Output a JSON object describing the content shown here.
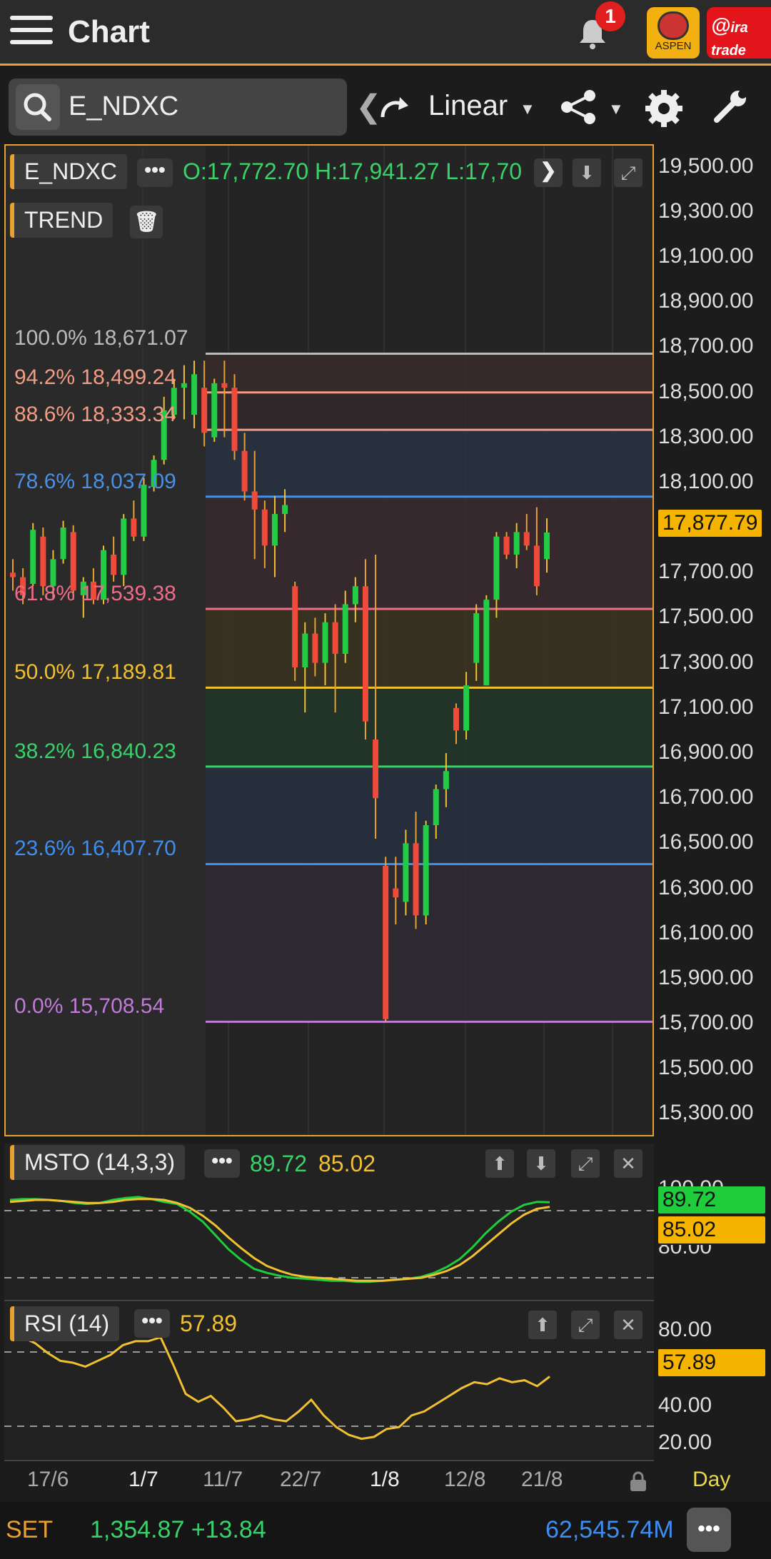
{
  "header": {
    "title": "Chart",
    "notification_count": "1",
    "aspen_label": "ASPEN",
    "ira_label": "ira\ntrade"
  },
  "toolbar": {
    "symbol": "E_NDXC",
    "scale": "Linear"
  },
  "main_panel": {
    "symbol": "E_NDXC",
    "ohlc": "O:17,772.70 H:17,941.27 L:17,70",
    "indicator": "TREND",
    "current_price": "17,877.79"
  },
  "fib_levels": [
    {
      "pct": "100.0%",
      "value": "18,671.07",
      "color": "#bbbbbb"
    },
    {
      "pct": "94.2%",
      "value": "18,499.24",
      "color": "#f29c84"
    },
    {
      "pct": "88.6%",
      "value": "18,333.34",
      "color": "#f29c84"
    },
    {
      "pct": "78.6%",
      "value": "18,037.09",
      "color": "#4a90e2"
    },
    {
      "pct": "61.8%",
      "value": "17,539.38",
      "color": "#ef6b8a"
    },
    {
      "pct": "50.0%",
      "value": "17,189.81",
      "color": "#f0c030"
    },
    {
      "pct": "38.2%",
      "value": "16,840.23",
      "color": "#3ad16a"
    },
    {
      "pct": "23.6%",
      "value": "16,407.70",
      "color": "#3d8ef0"
    },
    {
      "pct": "0.0%",
      "value": "15,708.54",
      "color": "#c07ad8"
    }
  ],
  "y_axis": [
    "19,500.00",
    "19,300.00",
    "19,100.00",
    "18,900.00",
    "18,700.00",
    "18,500.00",
    "18,300.00",
    "18,100.00",
    "17,700.00",
    "17,500.00",
    "17,300.00",
    "17,100.00",
    "16,900.00",
    "16,700.00",
    "16,500.00",
    "16,300.00",
    "16,100.00",
    "15,900.00",
    "15,700.00",
    "15,500.00",
    "15,300.00"
  ],
  "msto": {
    "label": "MSTO (14,3,3)",
    "k": "89.72",
    "d": "85.02",
    "axis_top": "100.00",
    "axis_bottom": "80.00"
  },
  "rsi": {
    "label": "RSI (14)",
    "value": "57.89",
    "axis": [
      "80.00",
      "40.00",
      "20.00"
    ]
  },
  "x_axis": [
    "17/6",
    "1/7",
    "11/7",
    "22/7",
    "1/8",
    "12/8",
    "21/8"
  ],
  "period": "Day",
  "status": {
    "market": "SET",
    "index": "1,354.87 +13.84",
    "volume": "62,545.74M"
  },
  "colors": {
    "accent": "#e8a030",
    "up": "#22cc44",
    "down": "#f04a3a",
    "price_tag": "#f5b400"
  },
  "chart_data": {
    "type": "candlestick",
    "candles": [
      [
        17700,
        17760,
        17620,
        17680
      ],
      [
        17680,
        17720,
        17560,
        17600
      ],
      [
        17650,
        17920,
        17640,
        17890
      ],
      [
        17860,
        17900,
        17600,
        17640
      ],
      [
        17640,
        17800,
        17580,
        17760
      ],
      [
        17760,
        17930,
        17740,
        17900
      ],
      [
        17880,
        17910,
        17580,
        17620
      ],
      [
        17600,
        17680,
        17500,
        17660
      ],
      [
        17660,
        17720,
        17560,
        17580
      ],
      [
        17580,
        17820,
        17560,
        17800
      ],
      [
        17780,
        17860,
        17660,
        17690
      ],
      [
        17690,
        17960,
        17640,
        17940
      ],
      [
        17940,
        18020,
        17840,
        17860
      ],
      [
        17860,
        18120,
        17840,
        18090
      ],
      [
        18080,
        18220,
        18060,
        18200
      ],
      [
        18200,
        18480,
        18180,
        18420
      ],
      [
        18400,
        18560,
        18380,
        18520
      ],
      [
        18520,
        18620,
        18380,
        18540
      ],
      [
        18400,
        18640,
        18340,
        18580
      ],
      [
        18520,
        18640,
        18260,
        18320
      ],
      [
        18300,
        18560,
        18280,
        18540
      ],
      [
        18540,
        18640,
        18300,
        18520
      ],
      [
        18520,
        18580,
        18200,
        18240
      ],
      [
        18240,
        18320,
        18020,
        18060
      ],
      [
        18060,
        18240,
        17760,
        17980
      ],
      [
        17980,
        18020,
        17720,
        17820
      ],
      [
        17820,
        18040,
        17680,
        17960
      ],
      [
        17960,
        18070,
        17880,
        18000
      ],
      [
        17640,
        17660,
        17220,
        17280
      ],
      [
        17280,
        17480,
        17080,
        17430
      ],
      [
        17430,
        17500,
        17240,
        17300
      ],
      [
        17300,
        17520,
        17200,
        17480
      ],
      [
        17480,
        17560,
        17080,
        17340
      ],
      [
        17340,
        17620,
        17300,
        17560
      ],
      [
        17560,
        17680,
        17480,
        17640
      ],
      [
        17640,
        17760,
        16960,
        17040
      ],
      [
        16960,
        17780,
        16520,
        16700
      ],
      [
        16400,
        16440,
        15708,
        15720
      ],
      [
        16300,
        16440,
        16140,
        16260
      ],
      [
        16240,
        16560,
        16180,
        16500
      ],
      [
        16500,
        16640,
        16120,
        16180
      ],
      [
        16180,
        16600,
        16140,
        16580
      ],
      [
        16580,
        16760,
        16520,
        16740
      ],
      [
        16740,
        16900,
        16660,
        16820
      ],
      [
        17100,
        17120,
        16940,
        17000
      ],
      [
        17000,
        17260,
        16960,
        17200
      ],
      [
        17300,
        17560,
        17220,
        17520
      ],
      [
        17200,
        17600,
        17200,
        17580
      ],
      [
        17580,
        17880,
        17500,
        17860
      ],
      [
        17860,
        17880,
        17760,
        17780
      ],
      [
        17780,
        17920,
        17720,
        17880
      ],
      [
        17880,
        17960,
        17800,
        17820
      ],
      [
        17820,
        17990,
        17600,
        17640
      ],
      [
        17760,
        17941,
        17700,
        17878
      ]
    ],
    "msto_k": [
      92,
      93,
      93,
      92,
      91,
      89,
      88,
      89,
      92,
      94,
      95,
      93,
      90,
      88,
      80,
      70,
      56,
      42,
      31,
      22,
      18,
      15,
      13,
      12,
      11,
      10,
      10,
      9,
      9,
      10,
      11,
      12,
      14,
      18,
      24,
      32,
      44,
      58,
      70,
      80,
      87,
      90,
      89.72
    ],
    "msto_d": [
      90,
      91,
      92,
      92,
      91,
      90,
      89,
      89,
      90,
      92,
      93,
      93,
      92,
      89,
      84,
      76,
      66,
      54,
      43,
      33,
      25,
      20,
      16,
      14,
      13,
      12,
      11,
      10,
      10,
      10,
      11,
      12,
      13,
      16,
      20,
      26,
      35,
      46,
      57,
      68,
      77,
      83,
      85.02
    ],
    "rsi": [
      78,
      78,
      75,
      70,
      66,
      65,
      63,
      66,
      69,
      74,
      76,
      76,
      78,
      64,
      49,
      45,
      48,
      42,
      35,
      36,
      38,
      36,
      35,
      40,
      46,
      38,
      32,
      28,
      26,
      27,
      31,
      32,
      38,
      40,
      44,
      48,
      52,
      55,
      54,
      57,
      55,
      56,
      53,
      57.89
    ],
    "y_range": [
      15200,
      19600
    ],
    "msto_range": [
      0,
      100
    ],
    "rsi_range": [
      20,
      80
    ]
  }
}
